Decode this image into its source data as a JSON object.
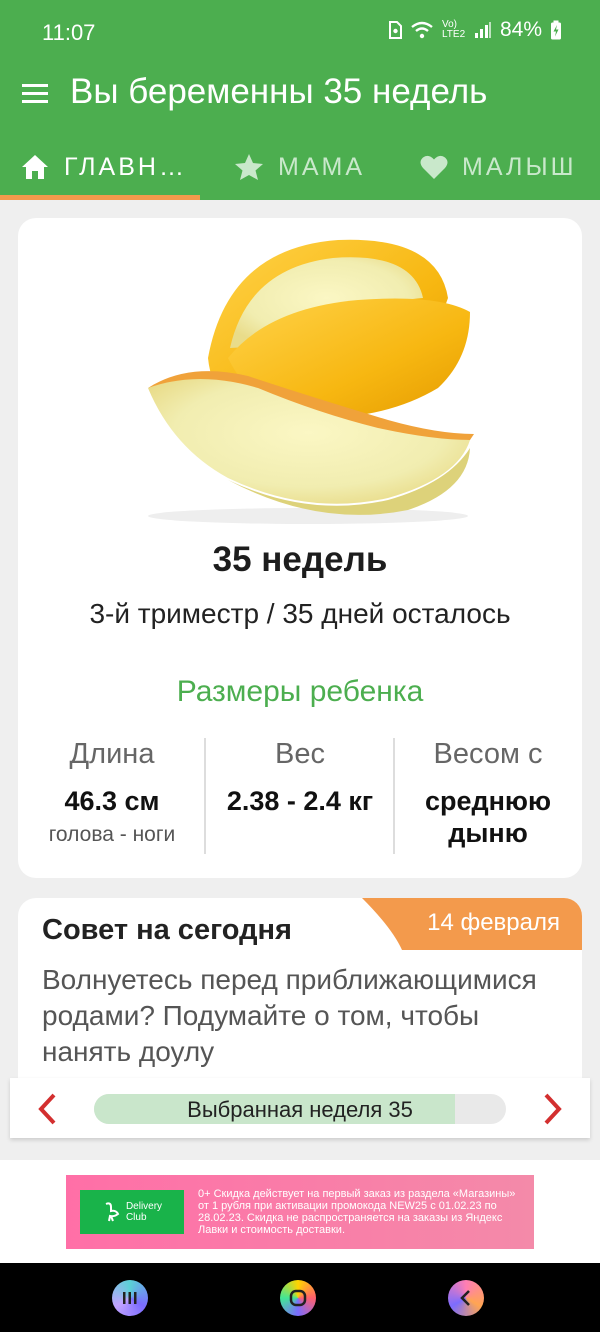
{
  "status_bar": {
    "time": "11:07",
    "network": "Vo) LTE2",
    "battery": "84%"
  },
  "app_bar": {
    "title": "Вы беременны 35 недель"
  },
  "tabs": [
    {
      "label": "ГЛАВН…",
      "icon": "home-icon",
      "active": true
    },
    {
      "label": "МАМА",
      "icon": "star-icon",
      "active": false
    },
    {
      "label": "МАЛЫШ",
      "icon": "heart-icon",
      "active": false
    }
  ],
  "week_card": {
    "image": "melon-image",
    "title": "35 недель",
    "subtitle": "3-й триместр / 35 дней осталось",
    "sizes_title": "Размеры ребенка",
    "stats": [
      {
        "label": "Длина",
        "value": "46.3 см",
        "sub": "голова - ноги"
      },
      {
        "label": "Вес",
        "value": "2.38 - 2.4 кг",
        "sub": ""
      },
      {
        "label": "Весом с",
        "value": "среднюю дыню",
        "sub": ""
      }
    ]
  },
  "tip": {
    "title": "Совет на сегодня",
    "date": "14 февраля",
    "text": "Волнуетесь перед приближающимися родами? Подумайте о том, чтобы нанять доулу"
  },
  "week_nav": {
    "label": "Выбранная неделя 35",
    "progress": 0.875
  },
  "ad": {
    "logo_line1": "Delivery",
    "logo_line2": "Club",
    "text": "0+ Скидка действует на первый заказ из раздела «Магазины» от 1 рубля при активации промокода NEW25 с 01.02.23 по 28.02.23. Скидка не распространяется на заказы из Яндекс Лавки и стоимость доставки."
  },
  "colors": {
    "primary": "#4cae4f",
    "accent": "#f39a4c",
    "nav_arrow": "#d32f2f"
  }
}
